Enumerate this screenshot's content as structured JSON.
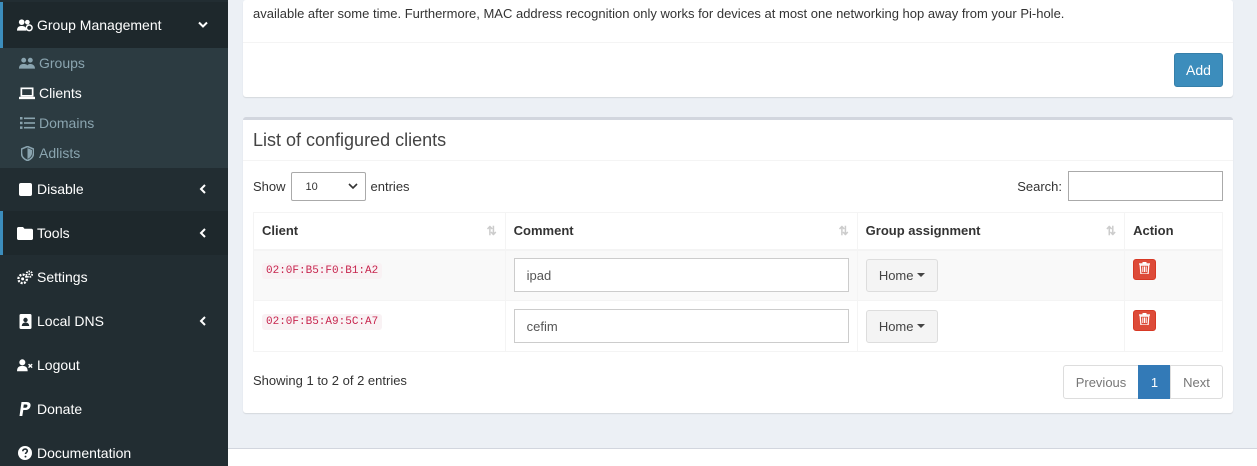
{
  "sidebar": {
    "group_management": "Group Management",
    "sub_items": [
      "Groups",
      "Clients",
      "Domains",
      "Adlists"
    ],
    "items": [
      {
        "label": "Disable"
      },
      {
        "label": "Tools"
      },
      {
        "label": "Settings"
      },
      {
        "label": "Local DNS"
      },
      {
        "label": "Logout"
      },
      {
        "label": "Donate"
      },
      {
        "label": "Documentation"
      }
    ]
  },
  "top_box": {
    "text": "available after some time. Furthermore, MAC address recognition only works for devices at most one networking hop away from your Pi-hole.",
    "add_label": "Add"
  },
  "list": {
    "title": "List of configured clients",
    "show_label": "Show",
    "entries_label": "entries",
    "page_length": "10",
    "search_label": "Search:",
    "search_value": "",
    "columns": [
      "Client",
      "Comment",
      "Group assignment",
      "Action"
    ],
    "rows": [
      {
        "client": "02:0F:B5:F0:B1:A2",
        "comment": "ipad",
        "group": "Home"
      },
      {
        "client": "02:0F:B5:A9:5C:A7",
        "comment": "cefim",
        "group": "Home"
      }
    ],
    "info": "Showing 1 to 2 of 2 entries",
    "pagination": {
      "previous": "Previous",
      "current": "1",
      "next": "Next"
    }
  },
  "colors": {
    "sidebar_bg": "#222d32",
    "primary": "#3c8dbc",
    "danger": "#dd4b39",
    "code": "#c7254e"
  }
}
